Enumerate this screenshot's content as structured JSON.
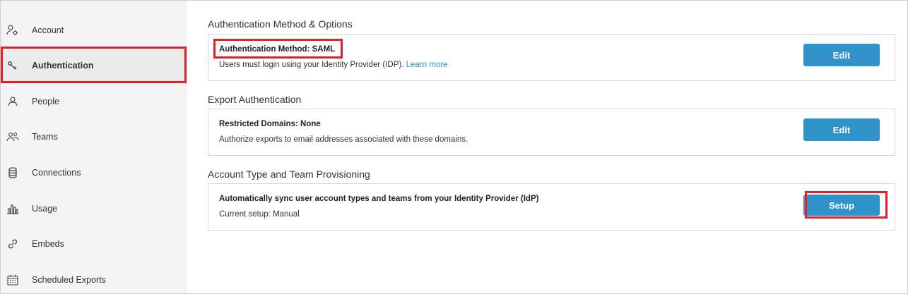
{
  "sidebar": {
    "items": [
      {
        "label": "Account",
        "icon": "account-settings-icon"
      },
      {
        "label": "Authentication",
        "icon": "key-icon",
        "active": true
      },
      {
        "label": "People",
        "icon": "person-icon"
      },
      {
        "label": "Teams",
        "icon": "teams-icon"
      },
      {
        "label": "Connections",
        "icon": "database-icon"
      },
      {
        "label": "Usage",
        "icon": "bar-chart-icon"
      },
      {
        "label": "Embeds",
        "icon": "link-icon"
      },
      {
        "label": "Scheduled Exports",
        "icon": "calendar-icon"
      }
    ]
  },
  "main": {
    "sections": [
      {
        "title": "Authentication Method & Options",
        "card_title": "Authentication Method: SAML",
        "card_desc": "Users must login using your Identity Provider (IDP).",
        "card_link": "Learn more",
        "button": "Edit"
      },
      {
        "title": "Export Authentication",
        "card_title": "Restricted Domains: None",
        "card_desc": "Authorize exports to email addresses associated with these domains.",
        "button": "Edit"
      },
      {
        "title": "Account Type and Team Provisioning",
        "card_title": "Automatically sync user account types and teams from your Identity Provider (IdP)",
        "card_desc": "Current setup: Manual",
        "button": "Setup"
      }
    ]
  },
  "colors": {
    "accent": "#2f93c9",
    "link": "#2f8fc7",
    "highlight": "#e0202a",
    "sidebar_bg": "#f4f4f4"
  }
}
